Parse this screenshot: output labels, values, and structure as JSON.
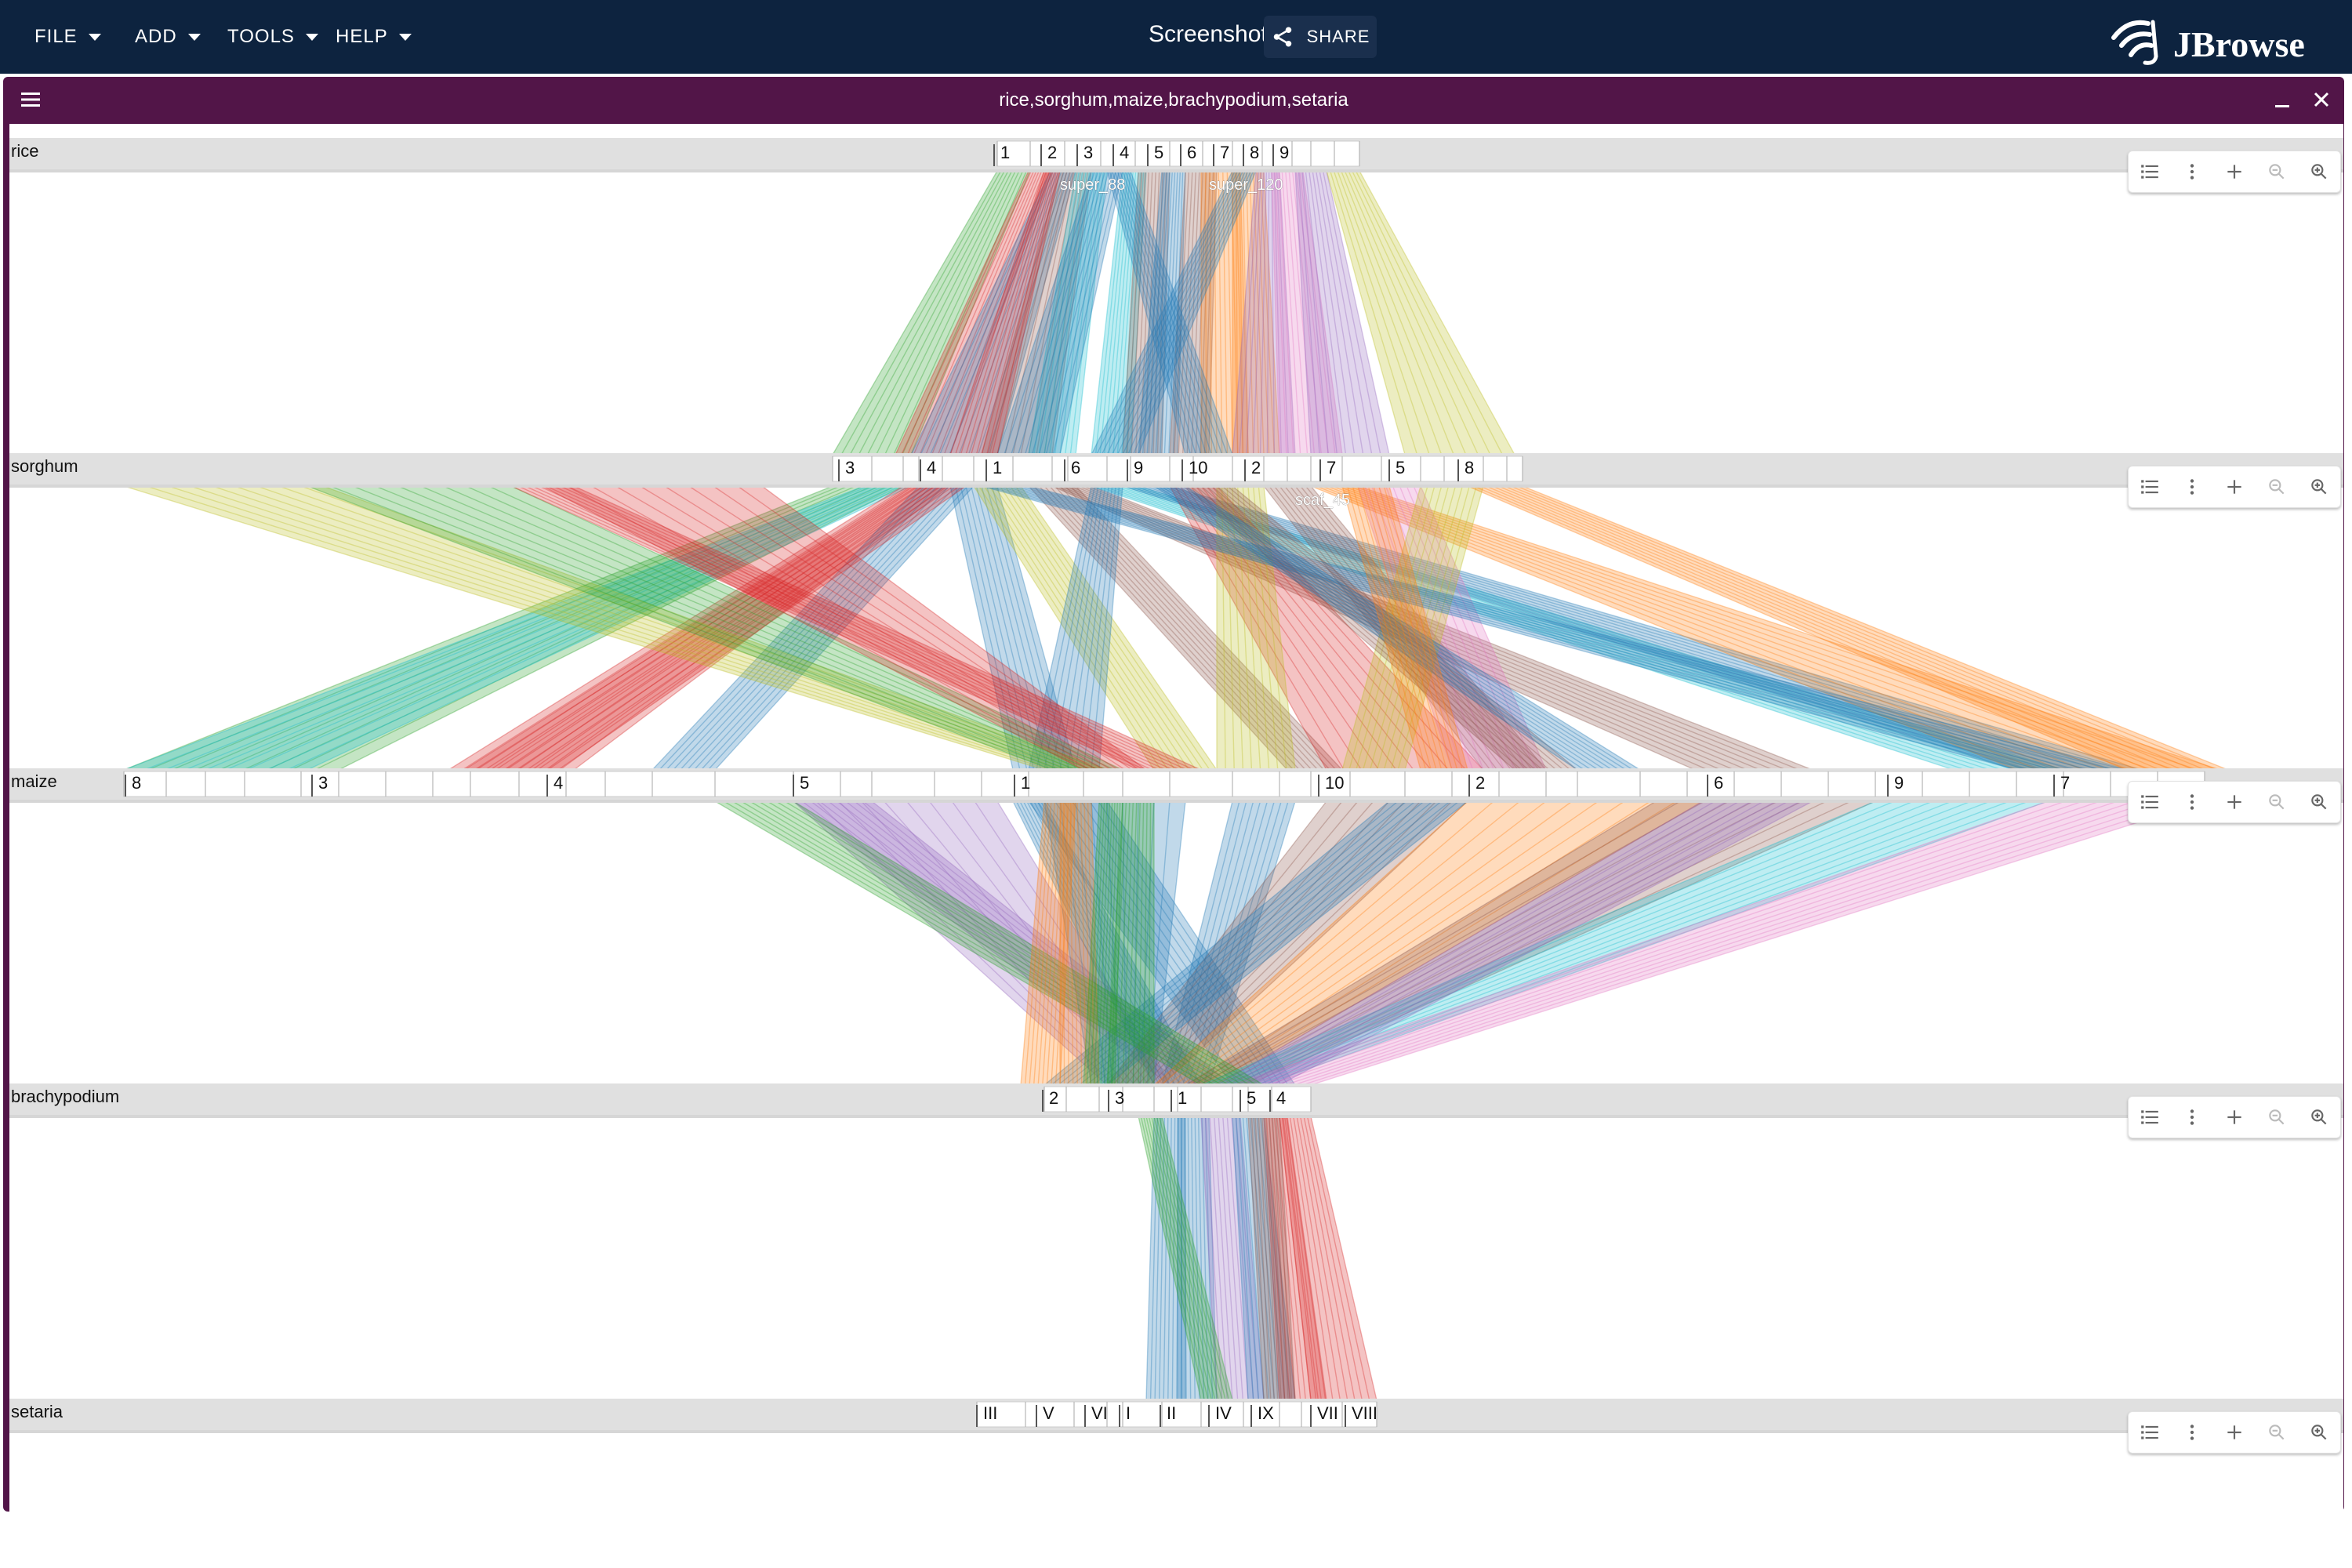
{
  "app": {
    "brand": "JBrowse",
    "session_name": "Screenshot",
    "share_label": "SHARE"
  },
  "menus": [
    {
      "label": "FILE"
    },
    {
      "label": "ADD"
    },
    {
      "label": "TOOLS"
    },
    {
      "label": "HELP"
    }
  ],
  "view": {
    "title": "rice,sorghum,maize,brachypodium,setaria",
    "accent_color": "#521548",
    "toolbar_icons": [
      "track-list-icon",
      "more-vert-icon",
      "collapse-icon",
      "swap-icon",
      "palette-icon",
      "tune-icon"
    ]
  },
  "colors": {
    "header": "#0d233f",
    "chromosome_palette": [
      "#2ca02c",
      "#d62728",
      "#1f77b4",
      "#8c564b",
      "#17becf",
      "#ff7f0e",
      "#9467bd",
      "#e377c2",
      "#bcbd22"
    ]
  },
  "assemblies": [
    {
      "name": "rice",
      "chromosomes": [
        "1",
        "2",
        "3",
        "4",
        "5",
        "6",
        "7",
        "8",
        "9"
      ],
      "scaffold_labels": [
        "super_88",
        "super_120"
      ]
    },
    {
      "name": "sorghum",
      "chromosomes": [
        "3",
        "4",
        "1",
        "6",
        "9",
        "10",
        "2",
        "7",
        "5",
        "8"
      ],
      "scaffold_labels": [
        "scaf_45"
      ]
    },
    {
      "name": "maize",
      "chromosomes": [
        "8",
        "3",
        "4",
        "5",
        "1",
        "10",
        "2",
        "6",
        "9",
        "7"
      ],
      "scaffold_labels": []
    },
    {
      "name": "brachypodium",
      "chromosomes": [
        "2",
        "3",
        "1",
        "5",
        "4"
      ],
      "scaffold_labels": []
    },
    {
      "name": "setaria",
      "chromosomes": [
        "III",
        "V",
        "VI",
        "I",
        "II",
        "IV",
        "IX",
        "VII",
        "VIII"
      ],
      "scaffold_labels": []
    }
  ],
  "track_controls": [
    "track-list-icon",
    "more-vert-icon",
    "add-icon",
    "zoom-out-icon",
    "zoom-in-icon"
  ]
}
